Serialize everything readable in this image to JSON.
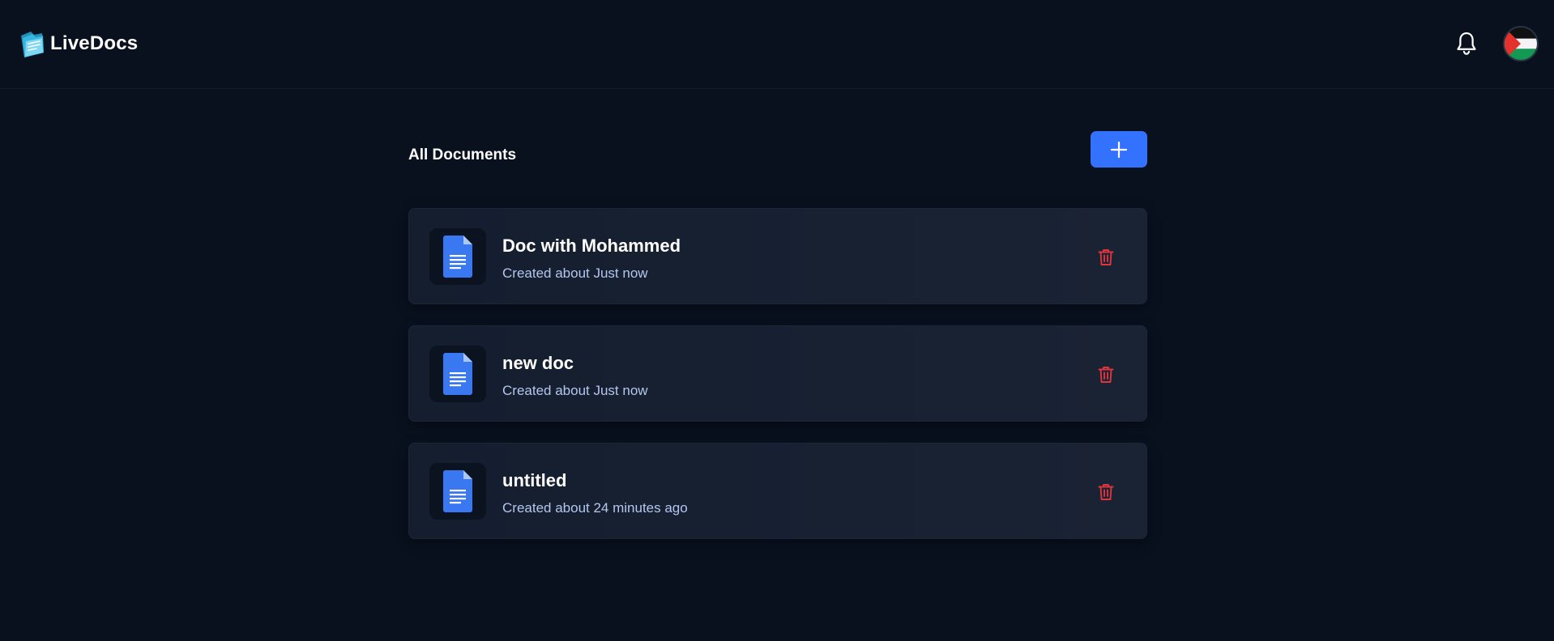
{
  "header": {
    "app_name": "LiveDocs",
    "logo_icon": "folder-icon",
    "notifications_icon": "bell-icon",
    "avatar_icon": "palestine-flag-avatar"
  },
  "main": {
    "title": "All Documents",
    "add_button_icon": "plus-icon",
    "documents": [
      {
        "title": "Doc with Mohammed",
        "subtitle": "Created about Just now",
        "icon": "document-icon",
        "action_icon": "trash-icon"
      },
      {
        "title": "new doc",
        "subtitle": "Created about Just now",
        "icon": "document-icon",
        "action_icon": "trash-icon"
      },
      {
        "title": "untitled",
        "subtitle": "Created about 24 minutes ago",
        "icon": "document-icon",
        "action_icon": "trash-icon"
      }
    ]
  },
  "colors": {
    "background": "#09111f",
    "accent": "#3371ff",
    "danger": "#e0353b",
    "subtitle": "#b4c6ee"
  }
}
